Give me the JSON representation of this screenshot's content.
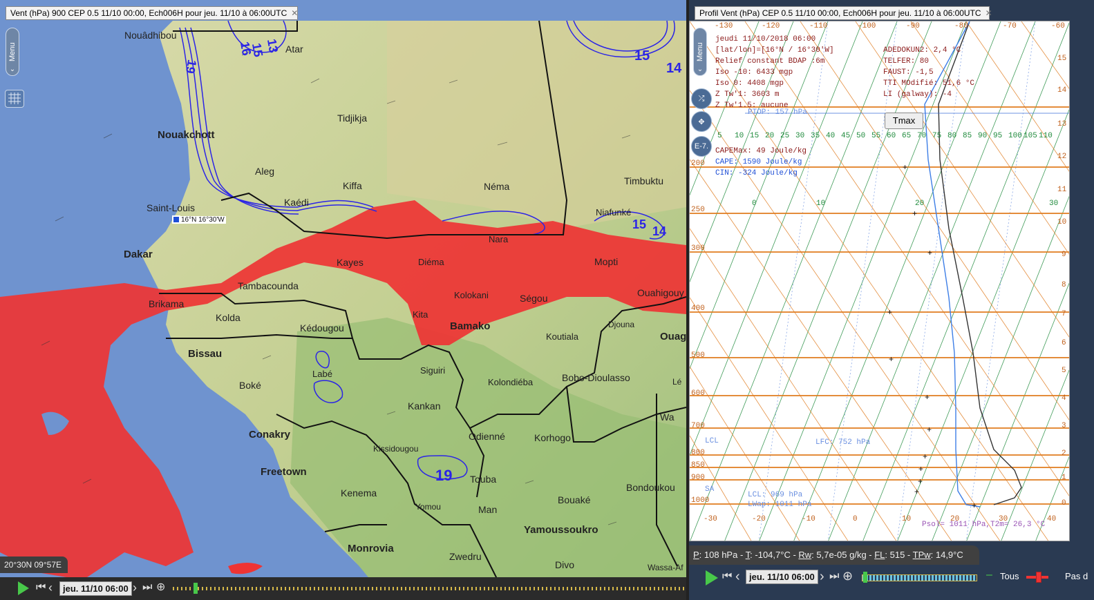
{
  "left_panel": {
    "tab_title": "Vent  (hPa) 900 CEP 0.5 11/10 00:00, Ech006H pour jeu. 11/10 à 06:00UTC",
    "menu_label": "Menu",
    "coords": "20°30N 09°57E",
    "point_label": "16°N 16°30'W",
    "cities": [
      {
        "name": "Nouâdhibou",
        "big": false
      },
      {
        "name": "Atar",
        "big": false
      },
      {
        "name": "Tidjikja",
        "big": false
      },
      {
        "name": "Nouakchott",
        "big": true
      },
      {
        "name": "Aleg",
        "big": false
      },
      {
        "name": "Kiffa",
        "big": false
      },
      {
        "name": "Néma",
        "big": false
      },
      {
        "name": "Timbuktu",
        "big": false
      },
      {
        "name": "Saint-Louis",
        "big": false
      },
      {
        "name": "Kaédi",
        "big": false
      },
      {
        "name": "Niafunké",
        "big": false
      },
      {
        "name": "Dakar",
        "big": true
      },
      {
        "name": "Nara",
        "big": false
      },
      {
        "name": "Kayes",
        "big": false
      },
      {
        "name": "Diéma",
        "big": false
      },
      {
        "name": "Mopti",
        "big": false
      },
      {
        "name": "Tambacounda",
        "big": false
      },
      {
        "name": "Kolokani",
        "big": false
      },
      {
        "name": "Ségou",
        "big": false
      },
      {
        "name": "Ouahigouy",
        "big": false
      },
      {
        "name": "Brikama",
        "big": false
      },
      {
        "name": "Kolda",
        "big": false
      },
      {
        "name": "Kita",
        "big": false
      },
      {
        "name": "Bamako",
        "big": true
      },
      {
        "name": "Djouna",
        "big": false
      },
      {
        "name": "Kédougou",
        "big": false
      },
      {
        "name": "Koutiala",
        "big": false
      },
      {
        "name": "Ouag",
        "big": true
      },
      {
        "name": "Bissau",
        "big": true
      },
      {
        "name": "Labé",
        "big": false
      },
      {
        "name": "Siguiri",
        "big": false
      },
      {
        "name": "Boké",
        "big": false
      },
      {
        "name": "Kolondiéba",
        "big": false
      },
      {
        "name": "Bobo-Dioulasso",
        "big": false
      },
      {
        "name": "Kankan",
        "big": false
      },
      {
        "name": "Conakry",
        "big": true
      },
      {
        "name": "Wa",
        "big": false
      },
      {
        "name": "Odienné",
        "big": false
      },
      {
        "name": "Korhogo",
        "big": false
      },
      {
        "name": "Freetown",
        "big": true
      },
      {
        "name": "Kissidougou",
        "big": false
      },
      {
        "name": "Kenema",
        "big": false
      },
      {
        "name": "Touba",
        "big": false
      },
      {
        "name": "Bondoukou",
        "big": false
      },
      {
        "name": "Yomou",
        "big": false
      },
      {
        "name": "Man",
        "big": false
      },
      {
        "name": "Bouaké",
        "big": false
      },
      {
        "name": "Yamoussoukro",
        "big": true
      },
      {
        "name": "Monrovia",
        "big": true
      },
      {
        "name": "Zwedru",
        "big": false
      },
      {
        "name": "Divo",
        "big": false
      },
      {
        "name": "Wassa-Af",
        "big": false
      },
      {
        "name": "Lé",
        "big": false
      }
    ],
    "contour_labels": [
      "16",
      "15",
      "13",
      "19",
      "15",
      "14",
      "15",
      "14",
      "19",
      "16",
      "15",
      "13"
    ],
    "date": "jeu. 11/10 06:00"
  },
  "right_panel": {
    "tab_title": "Profil Vent  (hPa) CEP 0.5 11/10 00:00, Ech006H pour jeu. 11/10 à 06:00UTC",
    "menu_label": "Menu",
    "btn_e7": "E-7.",
    "tmax_label": "Tmax",
    "info_left": [
      "jeudi 11/10/2018 06:00",
      "[lat/lon]=[16°N / 16°30'W]",
      "Relief constant BDAP :6m",
      "Iso -10: 6433 mgp",
      "Iso 0: 4408 mgp",
      "Z Tw'1: 3603 m",
      "Z Tw'1.5: aucune"
    ],
    "info_right": [
      "ADEDOKUN2: 2,4 °C",
      "TELFER: 80",
      "FAUST: -1,5",
      "TTI MOdifié: 51,6 °C",
      "LI (galway): -4"
    ],
    "ptop": "PTOP: 157 hPa",
    "cape_max": "CAPEMax: 49 Joule/kg",
    "cape": "CAPE: 1590 Joule/kg",
    "cin": "CIN: -324 Joule/kg",
    "lfc": "LFC: 752 hPa",
    "lcl": "LCL: 969 hPa",
    "lwap": "LWap: 1011 hPa",
    "psol": "Psol= 1011 hPa,T2m= 26,3 °C",
    "top_axis": [
      "-130",
      "-120",
      "-110",
      "-100",
      "-90",
      "-80",
      "-70",
      "-60"
    ],
    "green_scale": [
      "5",
      "10",
      "15",
      "20",
      "25",
      "30",
      "35",
      "40",
      "45",
      "50",
      "55",
      "60",
      "65",
      "70",
      "75",
      "80",
      "85",
      "90",
      "95",
      "100",
      "105",
      "110"
    ],
    "temp_axis": [
      "-30",
      "-20",
      "-10",
      "0",
      "10",
      "20",
      "30",
      "40"
    ],
    "mixing_axis": [
      "0",
      "10",
      "20",
      "30"
    ],
    "pressure_labels": [
      "200",
      "250",
      "300",
      "400",
      "500",
      "600",
      "700",
      "800",
      "850",
      "900",
      "1000"
    ],
    "side_labels": [
      "15",
      "14",
      "13",
      "12",
      "11",
      "10",
      "9",
      "8",
      "7",
      "6",
      "5",
      "4",
      "3",
      "2",
      "1",
      "0"
    ],
    "lcl_left": "LCL",
    "sa_left": "SA",
    "status": {
      "p_label": "P",
      "p_value": ": 108 hPa - ",
      "t_label": "T",
      "t_value": ": -104,7°C - ",
      "rw_label": "Rw",
      "rw_value": ": 5,7e-05 g/kg - ",
      "fl_label": "FL",
      "fl_value": ": 515 - ",
      "tpw_label": "TPw",
      "tpw_value": ": 14,9°C"
    },
    "date": "jeu. 11/10 06:00",
    "tous": "Tous",
    "pas": "Pas d"
  },
  "colors": {
    "sea": "#6f93cf",
    "land": "#b9c98f",
    "red_area": "#ee3434",
    "contour": "#2b24e6",
    "skewt_bg": "#ffffff",
    "isobar": "#e07b1e",
    "green_line": "#1e8a3b"
  }
}
